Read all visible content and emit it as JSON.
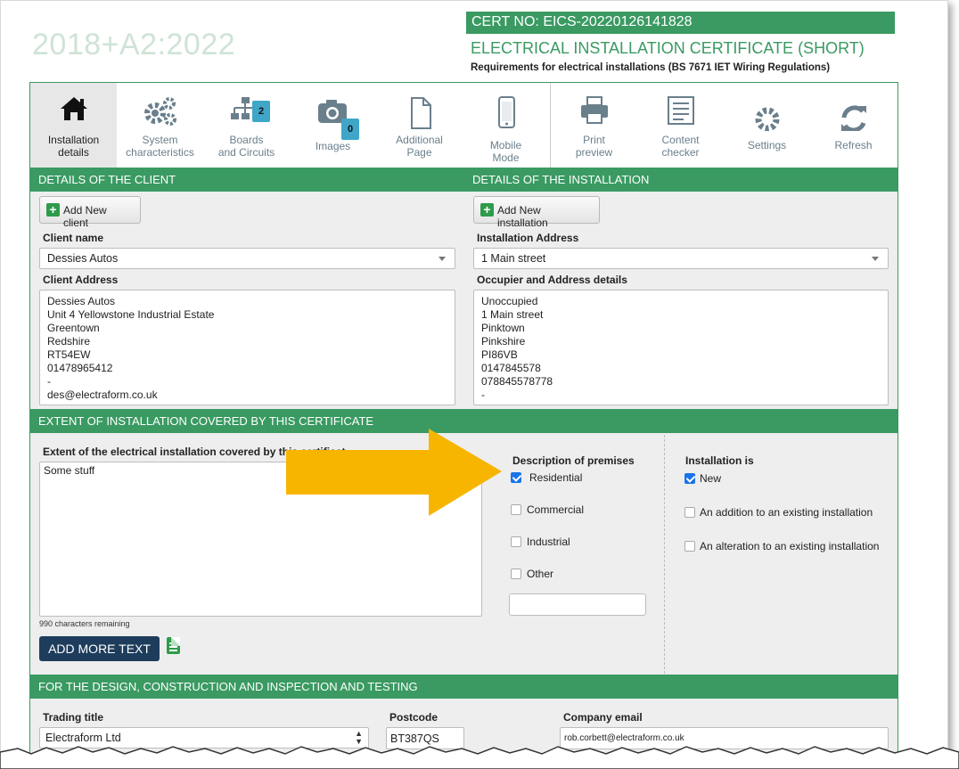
{
  "header": {
    "version": "2018+A2:2022",
    "cert_no": "CERT NO: EICS-20220126141828",
    "title": "ELECTRICAL INSTALLATION CERTIFICATE (SHORT)",
    "subtitle": "Requirements for electrical installations (BS 7671 IET Wiring Regulations)"
  },
  "toolbar": [
    {
      "id": "installation",
      "label": "Installation details",
      "icon": "home-icon",
      "active": true
    },
    {
      "id": "system",
      "label": "System characteristics",
      "icon": "gears-icon"
    },
    {
      "id": "boards",
      "label": "Boards and Circuits",
      "icon": "sitemap-icon",
      "badge": "2"
    },
    {
      "id": "images",
      "label": "Images",
      "icon": "camera-icon",
      "badge": "0"
    },
    {
      "id": "additional",
      "label": "Additional Page",
      "icon": "page-icon"
    },
    {
      "id": "mobile",
      "label": "Mobile Mode",
      "icon": "mobile-icon"
    },
    {
      "id": "print",
      "label": "Print preview",
      "icon": "printer-icon"
    },
    {
      "id": "content",
      "label": "Content checker",
      "icon": "checklist-icon"
    },
    {
      "id": "settings",
      "label": "Settings",
      "icon": "gear-icon"
    },
    {
      "id": "refresh",
      "label": "Refresh",
      "icon": "refresh-icon"
    }
  ],
  "client": {
    "section_title": "DETAILS OF THE CLIENT",
    "add_button": "Add New client",
    "name_label": "Client name",
    "name_value": "Dessies Autos",
    "address_label": "Client Address",
    "address_lines": [
      "Dessies Autos",
      "Unit 4 Yellowstone Industrial Estate",
      "Greentown",
      "Redshire",
      "RT54EW",
      "01478965412",
      "-",
      "des@electraform.co.uk"
    ]
  },
  "installation": {
    "section_title": "DETAILS OF THE INSTALLATION",
    "add_button": "Add New installation",
    "address_label": "Installation Address",
    "address_value": "1 Main street",
    "occupier_label": "Occupier and Address details",
    "occupier_lines": [
      "Unoccupied",
      "1 Main street",
      "Pinktown",
      "Pinkshire",
      "PI86VB",
      "0147845578",
      "078845578778",
      "-"
    ]
  },
  "extent": {
    "section_title": "EXTENT OF INSTALLATION COVERED BY THIS CERTIFICATE",
    "field_label": "Extent of the electrical installation covered by this certificat",
    "field_value": "Some stuff",
    "chars_remaining": "990 characters remaining",
    "add_more_text": "ADD MORE TEXT",
    "premises_label": "Description of premises",
    "premises_options": [
      {
        "label": "Residential",
        "checked": true
      },
      {
        "label": "Commercial",
        "checked": false
      },
      {
        "label": "Industrial",
        "checked": false
      },
      {
        "label": "Other",
        "checked": false
      }
    ],
    "other_value": "",
    "installation_is_label": "Installation is",
    "installation_is_options": [
      {
        "label": "New",
        "checked": true
      },
      {
        "label": "An addition to an existing installation",
        "checked": false
      },
      {
        "label": "An alteration to an existing installation",
        "checked": false
      }
    ]
  },
  "design": {
    "section_title": "FOR THE DESIGN, CONSTRUCTION AND INSPECTION AND TESTING",
    "trading_label": "Trading title",
    "trading_value": "Electraform Ltd",
    "postcode_label": "Postcode",
    "postcode_value": "BT387QS",
    "email_label": "Company email",
    "email_value": "rob.corbett@electraform.co.uk"
  },
  "colors": {
    "brand_green": "#3a9a62",
    "accent_arrow": "#f7b500",
    "button_navy": "#1e3d5c",
    "checkbox_blue": "#1a73e8"
  }
}
